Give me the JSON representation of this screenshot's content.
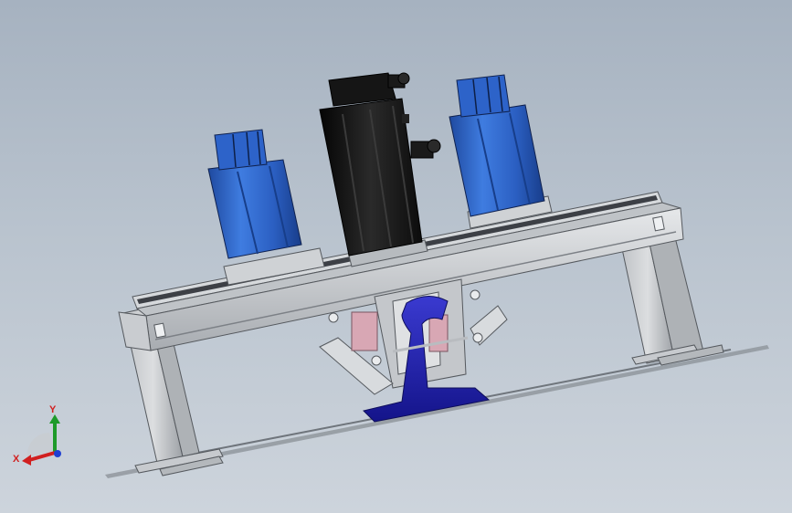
{
  "viewport": {
    "background_top": "#a6b2c0",
    "background_bottom": "#cdd4dc"
  },
  "model": {
    "frame_color": "#c9ccd0",
    "frame_shadow": "#8e9297",
    "servo_blue": "#2d5fbf",
    "servo_dark": "#121212",
    "rail_color": "#2323b0",
    "pink_part": "#d8a7b4",
    "parts": [
      {
        "name": "left-servo-motor",
        "color": "blue"
      },
      {
        "name": "center-servo-motor",
        "color": "black"
      },
      {
        "name": "right-servo-motor",
        "color": "blue"
      },
      {
        "name": "gantry-frame",
        "color": "gray"
      },
      {
        "name": "rail-section",
        "color": "blue"
      },
      {
        "name": "ground-line",
        "color": "gray"
      }
    ]
  },
  "triad": {
    "x_label": "X",
    "y_label": "Y",
    "x_color": "#d11f1f",
    "y_color": "#1e9a2a",
    "z_color": "#1f3fd1"
  }
}
